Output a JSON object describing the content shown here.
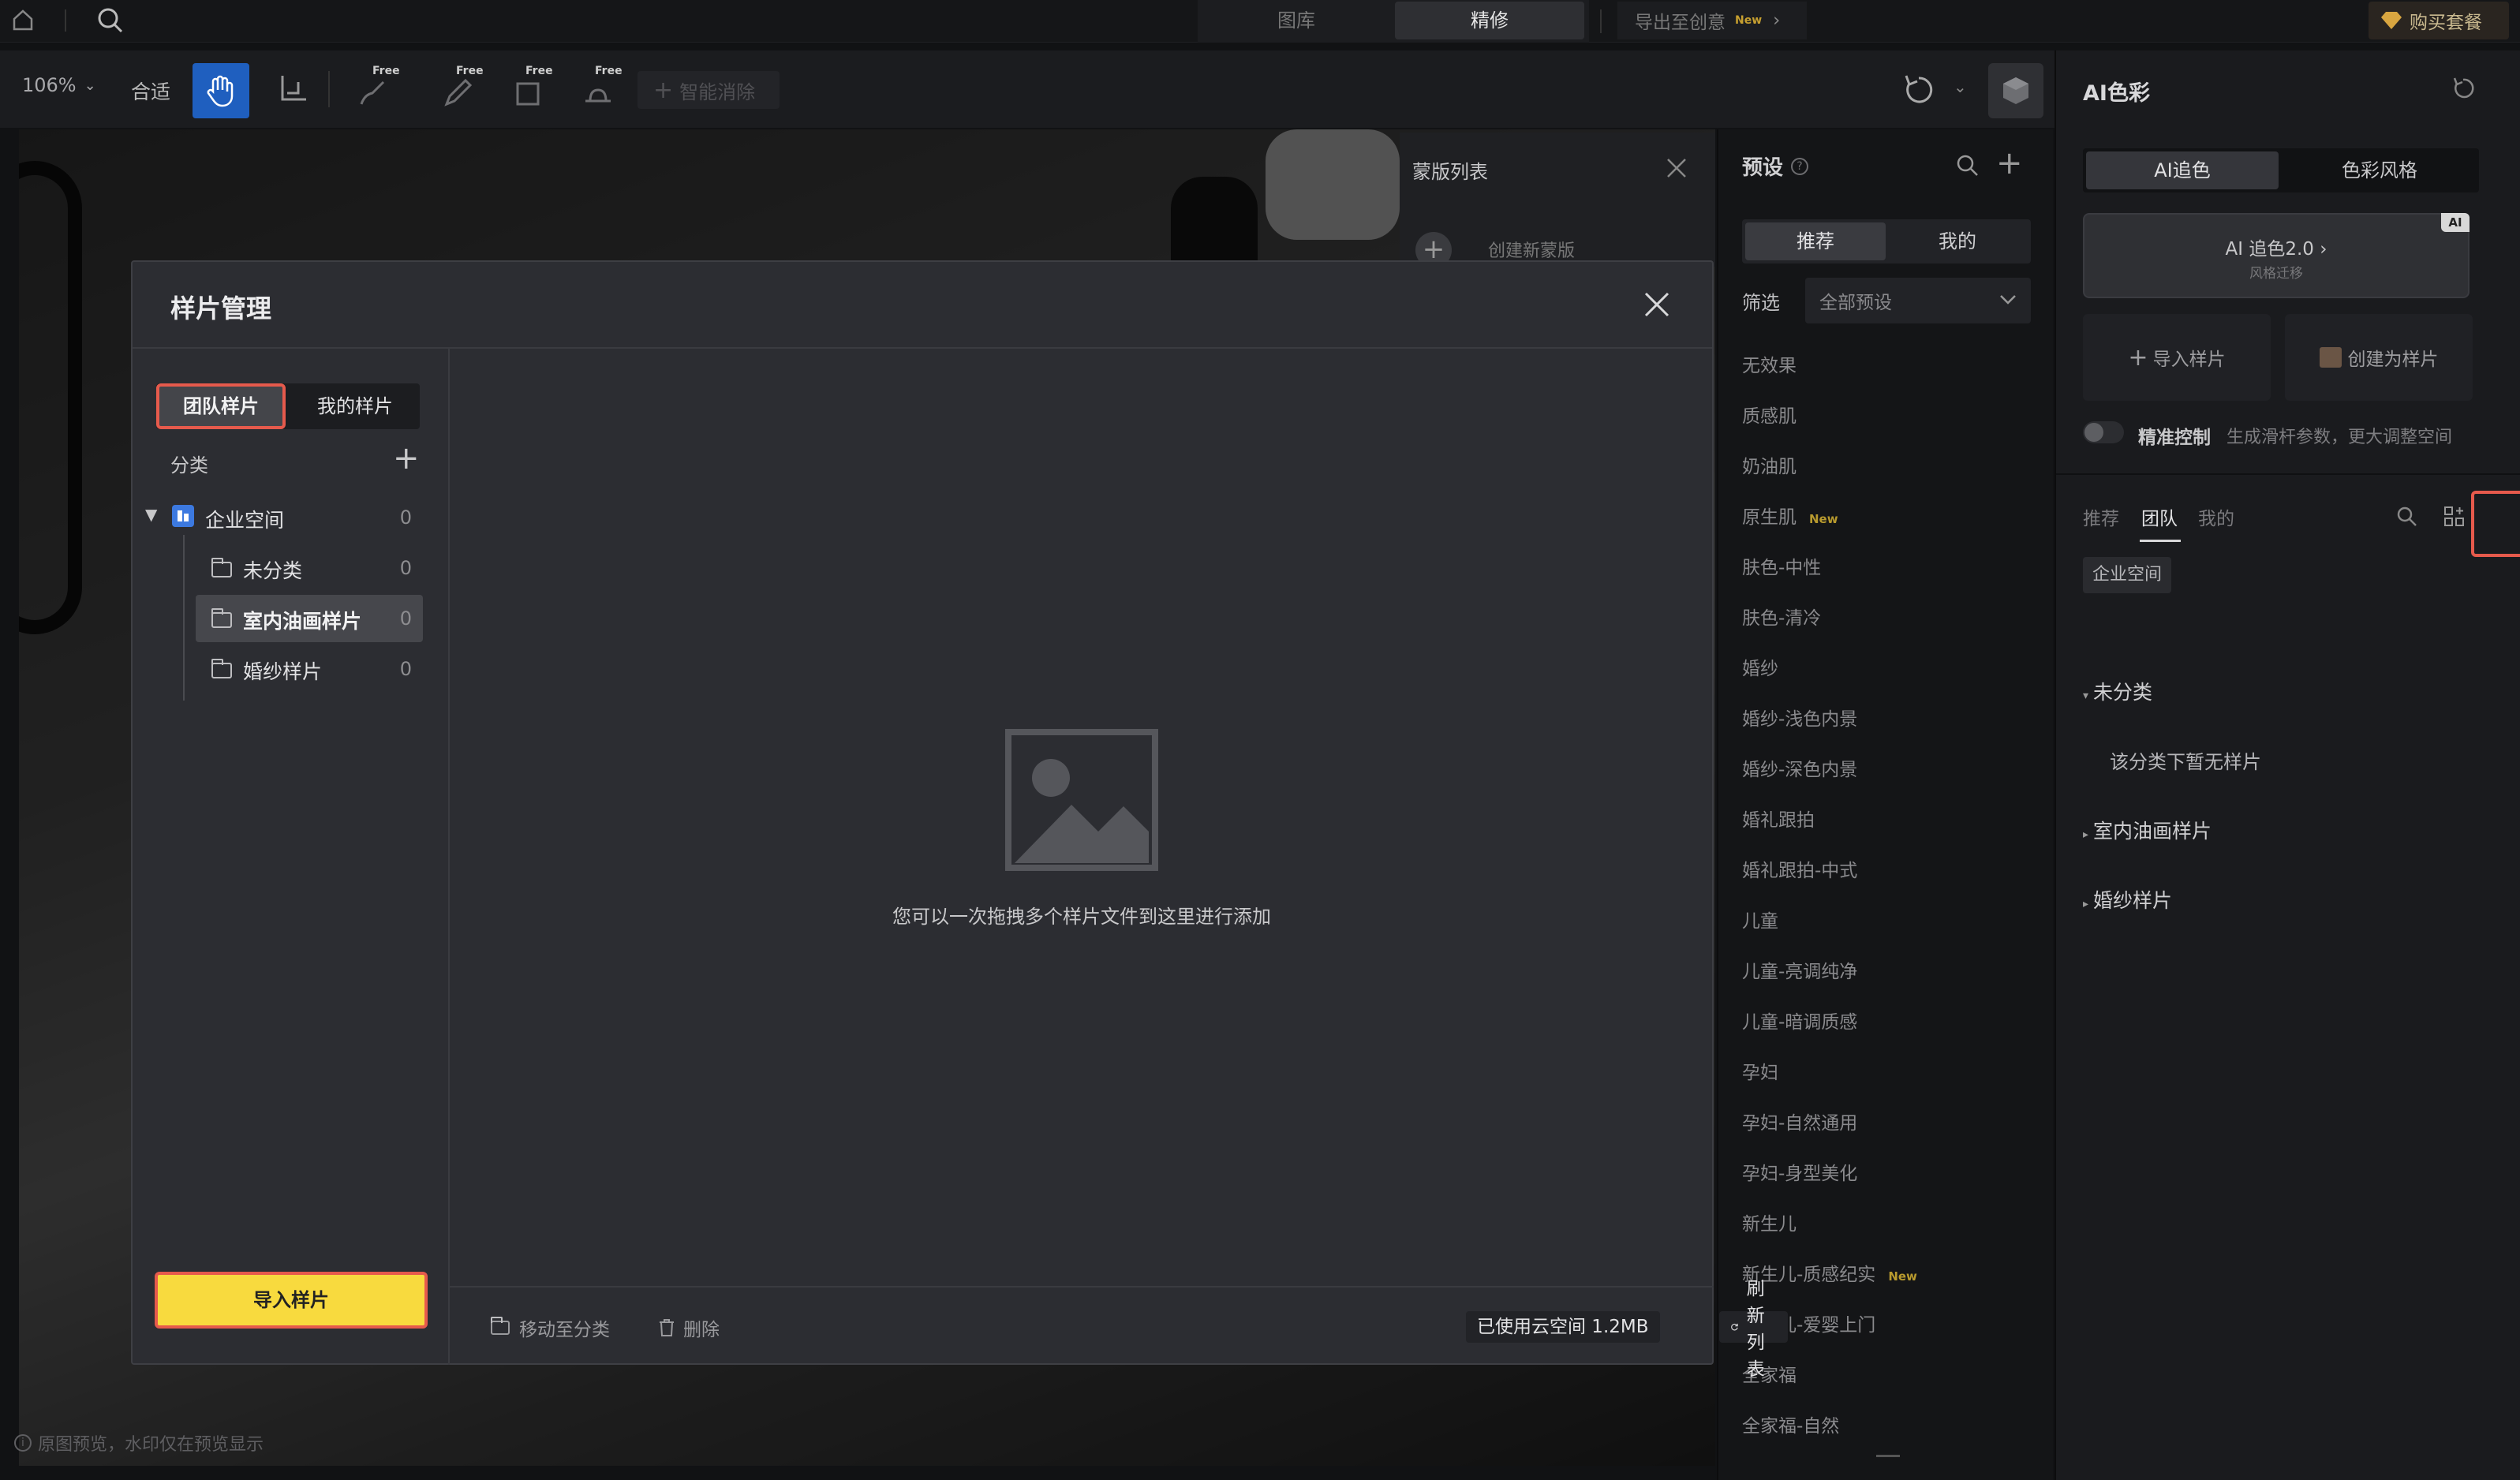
{
  "topbar": {
    "tabs": [
      {
        "label": "图库"
      },
      {
        "label": "精修",
        "active": true
      }
    ],
    "export_label": "导出至创意",
    "export_badge": "New",
    "buy_label": "购买套餐"
  },
  "toolbar": {
    "zoom": "106%",
    "fit_label": "合适",
    "free_tag": "Free",
    "smart_erase_label": "智能消除"
  },
  "mask_panel": {
    "title": "蒙版列表",
    "create_label": "创建新蒙版"
  },
  "presets": {
    "title": "预设",
    "tabs": [
      "推荐",
      "我的"
    ],
    "filter_label": "筛选",
    "filter_value": "全部预设",
    "new_tag": "New",
    "items": [
      {
        "label": "无效果"
      },
      {
        "label": "质感肌"
      },
      {
        "label": "奶油肌"
      },
      {
        "label": "原生肌",
        "is_new": true
      },
      {
        "label": "肤色-中性"
      },
      {
        "label": "肤色-清冷"
      },
      {
        "label": "婚纱"
      },
      {
        "label": "婚纱-浅色内景"
      },
      {
        "label": "婚纱-深色内景"
      },
      {
        "label": "婚礼跟拍"
      },
      {
        "label": "婚礼跟拍-中式"
      },
      {
        "label": "儿童"
      },
      {
        "label": "儿童-亮调纯净"
      },
      {
        "label": "儿童-暗调质感"
      },
      {
        "label": "孕妇"
      },
      {
        "label": "孕妇-自然通用"
      },
      {
        "label": "孕妇-身型美化"
      },
      {
        "label": "新生儿"
      },
      {
        "label": "新生儿-质感纪实",
        "is_new": true
      },
      {
        "label": "新生儿-爱婴上门"
      },
      {
        "label": "全家福"
      },
      {
        "label": "全家福-自然"
      }
    ]
  },
  "ai_color": {
    "title": "AI色彩",
    "tabs": [
      "AI追色",
      "色彩风格"
    ],
    "card_title": "AI 追色2.0 ›",
    "card_subtitle": "风格迁移",
    "card_badge": "AI",
    "import_label": "导入样片",
    "create_label": "创建为样片",
    "precise_label": "精准控制",
    "precise_desc": "生成滑杆参数，更大调整空间",
    "sample_tabs": [
      "推荐",
      "团队",
      "我的"
    ],
    "space_chip": "企业空间",
    "groups": [
      {
        "label": "未分类",
        "expanded": true,
        "empty_text": "该分类下暂无样片"
      },
      {
        "label": "室内油画样片"
      },
      {
        "label": "婚纱样片"
      }
    ]
  },
  "modal": {
    "title": "样片管理",
    "tabs": [
      {
        "label": "团队样片",
        "active": true
      },
      {
        "label": "我的样片"
      }
    ],
    "category_label": "分类",
    "tree": {
      "root": {
        "label": "企业空间",
        "count": "0"
      },
      "children": [
        {
          "label": "未分类",
          "count": "0"
        },
        {
          "label": "室内油画样片",
          "count": "0",
          "selected": true
        },
        {
          "label": "婚纱样片",
          "count": "0"
        }
      ]
    },
    "empty_hint": "您可以一次拖拽多个样片文件到这里进行添加",
    "import_button": "导入样片",
    "move_label": "移动至分类",
    "delete_label": "删除",
    "storage_label": "已使用云空间 1.2MB",
    "refresh_label": "刷新列表"
  },
  "status": {
    "preview_note": "原图预览，水印仅在预览显示"
  },
  "colors": {
    "accent_yellow": "#f8da3e",
    "highlight_red": "#e65a4c",
    "active_blue": "#1f5fbf"
  }
}
